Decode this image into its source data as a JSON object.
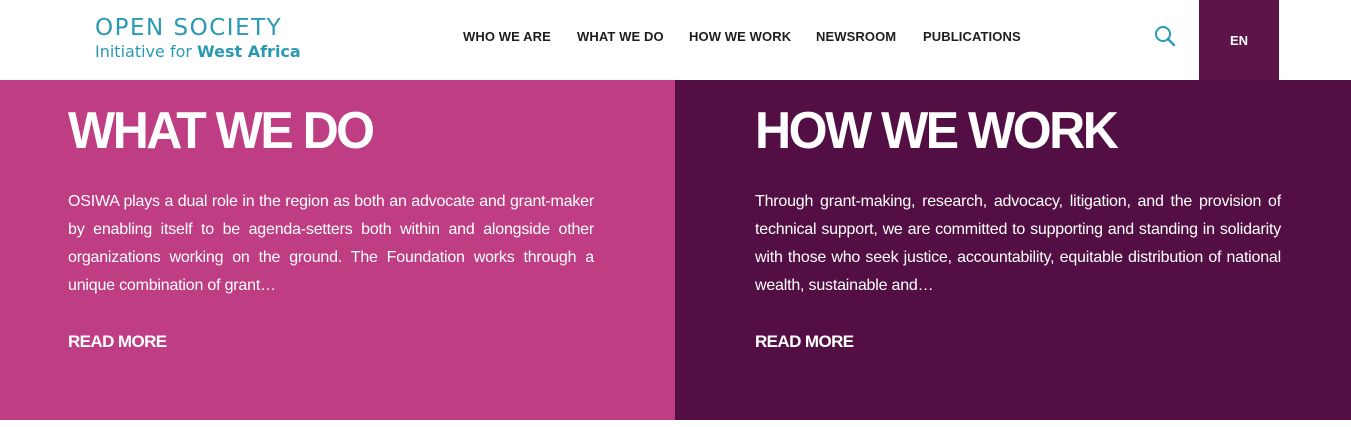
{
  "header": {
    "logo": {
      "line1": "OPEN SOCIETY",
      "line2_prefix": "Initiative for ",
      "line2_strong": "West Africa"
    },
    "nav": [
      {
        "label": "WHO WE ARE"
      },
      {
        "label": "WHAT WE DO"
      },
      {
        "label": "HOW WE WORK"
      },
      {
        "label": "NEWSROOM"
      },
      {
        "label": "PUBLICATIONS"
      }
    ],
    "search_icon": "search-icon",
    "language": "EN"
  },
  "panels": [
    {
      "title": "WHAT WE DO",
      "body": "OSIWA plays a dual role in the region as both an advocate and grant-maker by enabling itself to be agenda-setters both within and alongside other organizations working on the ground. The Foundation works through a unique combination of grant…",
      "link": "READ MORE"
    },
    {
      "title": "HOW WE WORK",
      "body": "Through grant-making, research, advocacy, litigation, and the provision of technical support, we are committed to supporting and standing in solidarity with those who seek justice, accountability, equitable distribution of national wealth, sustainable and…",
      "link": "READ MORE"
    }
  ],
  "colors": {
    "brand_teal": "#2a9ab4",
    "magenta": "#bf3d83",
    "plum": "#530f44",
    "lang_bg": "#5c1449"
  }
}
